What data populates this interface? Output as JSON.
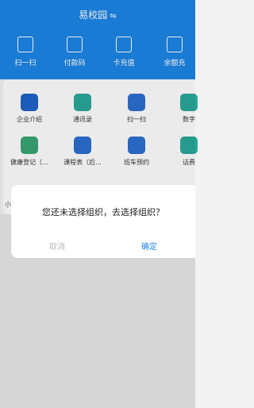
{
  "header": {
    "title": "易校园",
    "title_icon": "swap-icon"
  },
  "quick_actions": [
    {
      "label": "扫一扫",
      "icon": "scan-icon"
    },
    {
      "label": "付款码",
      "icon": "qr-code-icon"
    },
    {
      "label": "卡充值",
      "icon": "card-recharge-icon"
    },
    {
      "label": "余额充",
      "icon": "balance-icon"
    }
  ],
  "apps": [
    {
      "label": "企业介绍",
      "icon": "company-icon",
      "color": "#1f64c8"
    },
    {
      "label": "通讯录",
      "icon": "contacts-icon",
      "color": "#2aa89a"
    },
    {
      "label": "扫一扫",
      "icon": "scan-icon",
      "color": "#2c6fd0"
    },
    {
      "label": "数字",
      "icon": "digital-icon",
      "color": "#2aa89a"
    },
    {
      "label": "健康登记（...",
      "icon": "health-icon",
      "color": "#3aa573"
    },
    {
      "label": "课程表（后...",
      "icon": "calendar-icon",
      "color": "#2c6fd0"
    },
    {
      "label": "班车预约",
      "icon": "bus-icon",
      "color": "#2c6fd0"
    },
    {
      "label": "话费",
      "icon": "phone-bill-icon",
      "color": "#2aa89a"
    }
  ],
  "behind_text": "小",
  "dialog": {
    "message": "您还未选择组织，去选择组织？",
    "cancel_label": "取消",
    "confirm_label": "确定"
  },
  "colors": {
    "primary": "#1d86e6",
    "cancel_text": "#b8b8b8"
  }
}
